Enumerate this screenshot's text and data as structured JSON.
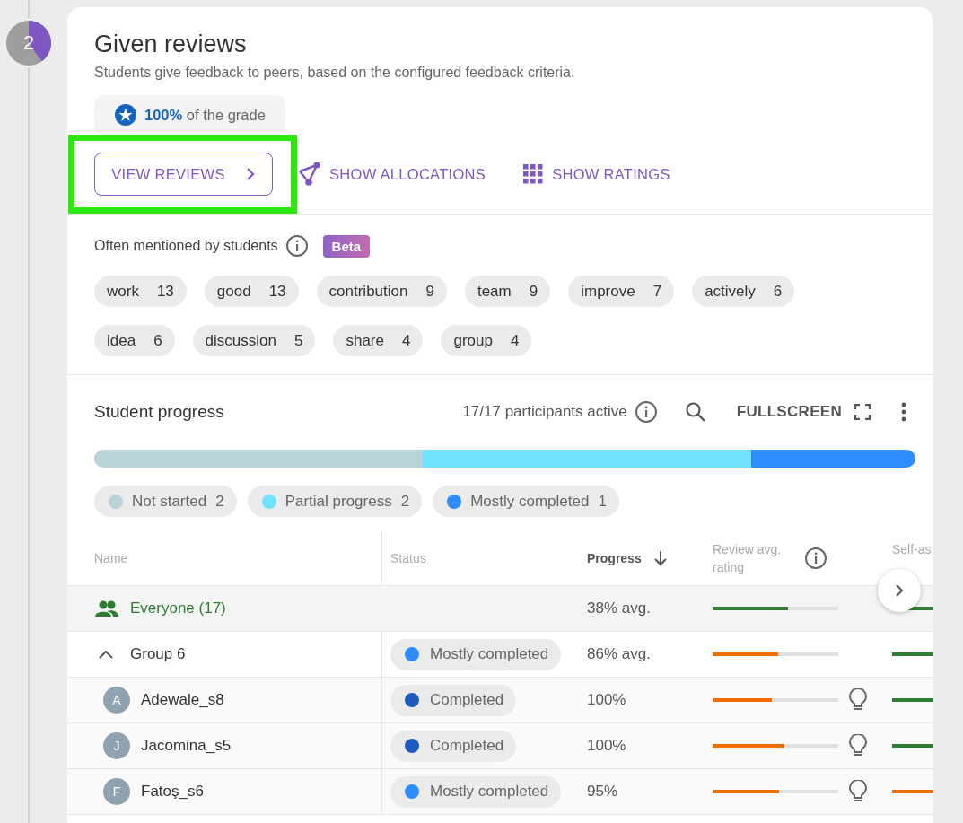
{
  "step": {
    "number": "2",
    "level": 0.4
  },
  "card": {
    "title": "Given reviews",
    "subtitle": "Students give feedback to peers, based on the configured feedback criteria.",
    "grade": "**100%** of the grade"
  },
  "actions": [
    {
      "kind": "outlined",
      "label": "VIEW REVIEWS",
      "highlighted": true
    },
    {
      "kind": "allocations",
      "label": "SHOW ALLOCATIONS",
      "highlighted": false
    },
    {
      "kind": "ratings",
      "label": "SHOW RATINGS",
      "highlighted": false
    }
  ],
  "keywords": {
    "title": "Often mentioned by students",
    "badge": "Beta",
    "items": [
      {
        "word": "work",
        "count": "13"
      },
      {
        "word": "good",
        "count": "13"
      },
      {
        "word": "contribution",
        "count": "9"
      },
      {
        "word": "team",
        "count": "9"
      },
      {
        "word": "improve",
        "count": "7"
      },
      {
        "word": "actively",
        "count": "6"
      },
      {
        "word": "idea",
        "count": "6"
      },
      {
        "word": "discussion",
        "count": "5"
      },
      {
        "word": "share",
        "count": "4"
      },
      {
        "word": "group",
        "count": "4"
      }
    ]
  },
  "progress": {
    "title": "Student progress",
    "active": "17/17 participants active",
    "fullscreen": "FULLSCREEN",
    "segments": [
      {
        "label": "Not started",
        "count": "2",
        "color": "#b8d3da"
      },
      {
        "label": "Partial progress",
        "count": "2",
        "color": "#6fe3ff"
      },
      {
        "label": "Mostly completed",
        "count": "1",
        "color": "#2d8cff"
      }
    ]
  },
  "table": {
    "columns": [
      {
        "label": "Name",
        "sorted": false
      },
      {
        "label": "Status",
        "sorted": false
      },
      {
        "label": "Progress",
        "sorted": true
      },
      {
        "label": "Review avg. rating",
        "sorted": false
      },
      {
        "label": "Self-as",
        "sorted": false
      }
    ],
    "rows": [
      {
        "kind": "total",
        "name": "Everyone (17)",
        "progress": "38% avg.",
        "review": {
          "level": 0.6,
          "color": "#2e7d32"
        },
        "self_rating": {
          "color": "#2e7d32"
        }
      },
      {
        "kind": "group",
        "name": "Group 6",
        "expanded": true,
        "status": {
          "label": "Mostly completed",
          "color": "#2d8cff"
        },
        "progress": "86% avg.",
        "review": {
          "level": 0.52,
          "color": "#ef6c00"
        },
        "self_rating": {
          "color": "#2e7d32"
        }
      },
      {
        "kind": "student",
        "initial": "A",
        "name": "Adewale_s8",
        "status": {
          "label": "Completed",
          "color": "#1e5bbf"
        },
        "progress": "100%",
        "review": {
          "level": 0.47,
          "color": "#ef6c00"
        },
        "self_rating": {
          "color": "#2e7d32"
        }
      },
      {
        "kind": "student",
        "initial": "J",
        "name": "Jacomina_s5",
        "status": {
          "label": "Completed",
          "color": "#1e5bbf"
        },
        "progress": "100%",
        "review": {
          "level": 0.57,
          "color": "#ef6c00"
        },
        "self_rating": {
          "color": "#2e7d32"
        }
      },
      {
        "kind": "student",
        "initial": "F",
        "name": "Fatoş_s6",
        "status": {
          "label": "Mostly completed",
          "color": "#2d8cff"
        },
        "progress": "95%",
        "review": {
          "level": 0.53,
          "color": "#ef6c00"
        },
        "self_rating": {
          "color": "#ef6c00"
        }
      }
    ]
  }
}
